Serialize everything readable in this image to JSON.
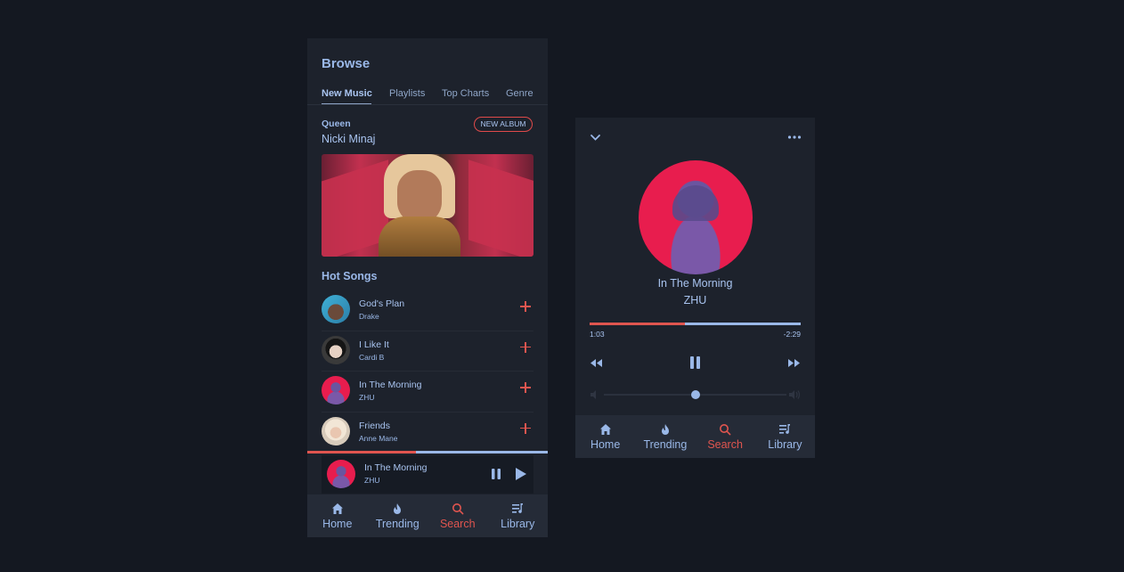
{
  "browse": {
    "title": "Browse",
    "tabs": [
      "New Music",
      "Playlists",
      "Top Charts",
      "Genre"
    ],
    "active_tab": "New Music"
  },
  "featured": {
    "album": "Queen",
    "artist": "Nicki Minaj",
    "badge": "NEW ALBUM"
  },
  "hot_songs": {
    "title": "Hot Songs",
    "items": [
      {
        "title": "God's Plan",
        "artist": "Drake"
      },
      {
        "title": "I Like It",
        "artist": "Cardi B"
      },
      {
        "title": "In The Morning",
        "artist": "ZHU"
      },
      {
        "title": "Friends",
        "artist": "Anne Mane"
      }
    ]
  },
  "mini_player": {
    "title": "In The Morning",
    "artist": "ZHU",
    "progress": 0.45
  },
  "nav": {
    "items": [
      "Home",
      "Trending",
      "Search",
      "Library"
    ],
    "active": "Search"
  },
  "now_playing": {
    "title": "In The Morning",
    "artist": "ZHU",
    "elapsed": "1:03",
    "remaining": "-2:29",
    "progress": 0.45,
    "volume": 0.5
  },
  "colors": {
    "accent": "#e0554f",
    "text": "#9ab8e8",
    "background": "#141821",
    "panel": "#1d222c"
  },
  "icons": [
    "chevron-down-icon",
    "more-icon",
    "rewind-icon",
    "pause-icon",
    "forward-icon",
    "play-icon",
    "plus-icon",
    "home-icon",
    "flame-icon",
    "search-icon",
    "library-icon",
    "volume-low-icon",
    "volume-high-icon"
  ]
}
